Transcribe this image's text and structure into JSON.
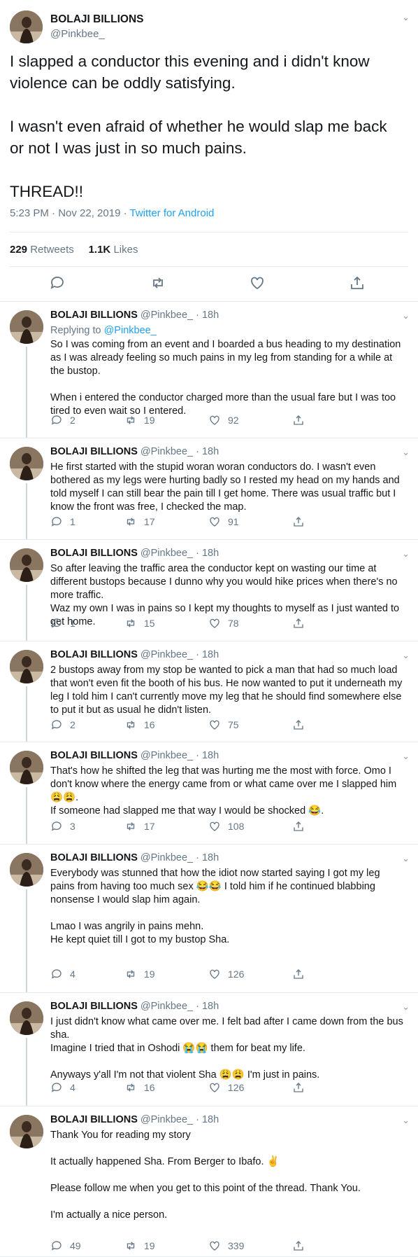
{
  "main_tweet": {
    "display_name": "BOLAJI BILLIONS",
    "handle": "@Pinkbee_",
    "text": "I slapped a conductor this evening and i didn't know violence can be oddly satisfying.\n\nI wasn't even afraid of whether he would slap me back or not I was just in so much pains.\n\nTHREAD!!",
    "timestamp": "5:23 PM · Nov 22, 2019 · ",
    "source": "Twitter for Android",
    "retweets_count": "229",
    "retweets_label": "Retweets",
    "likes_count": "1.1K",
    "likes_label": "Likes",
    "actions": [
      "reply-icon",
      "retweet-icon",
      "like-icon",
      "share-icon"
    ]
  },
  "replies": [
    {
      "display_name": "BOLAJI BILLIONS",
      "meta": "@Pinkbee_ · 18h",
      "replying_to_label": "Replying to ",
      "replying_to": "@Pinkbee_",
      "text": "So I was coming from an event and I boarded a bus heading to my destination as I was already feeling so much pains in my leg from standing for a while at the bustop.\n\nWhen i entered the conductor charged more than the usual fare but I was too tired to even wait so I entered.",
      "replies": "2",
      "retweets": "19",
      "likes": "92"
    },
    {
      "display_name": "BOLAJI BILLIONS",
      "meta": "@Pinkbee_ · 18h",
      "text": "He first started with the stupid woran woran conductors do. I wasn't even bothered as my legs were hurting badly so I rested my head on my hands and told myself I can still bear the pain till I get home. There was usual traffic but I know the front was free, I checked the map.",
      "replies": "1",
      "retweets": "17",
      "likes": "91"
    },
    {
      "display_name": "BOLAJI BILLIONS",
      "meta": "@Pinkbee_ · 18h",
      "text": "So after leaving the traffic area the conductor kept on wasting our time at different bustops because I dunno why you would hike prices when there's no more traffic.\nWaz my own I was in pains so I kept my thoughts to myself as I just wanted to get home.",
      "replies": "1",
      "retweets": "15",
      "likes": "78"
    },
    {
      "display_name": "BOLAJI BILLIONS",
      "meta": "@Pinkbee_ · 18h",
      "text": "2 bustops away from my stop be wanted to pick a man that had so much load that won't even fit the booth of his bus. He now wanted to put it underneath my leg I told him I can't currently move my leg that he should find somewhere else to put it but as usual he didn't listen.",
      "replies": "2",
      "retweets": "16",
      "likes": "75"
    },
    {
      "display_name": "BOLAJI BILLIONS",
      "meta": "@Pinkbee_ · 18h",
      "text": "That's how he shifted the leg that was hurting me the most with force. Omo I don't know where the energy came from or what came over me I slapped him 😩😩.\nIf someone had slapped me that way I would be shocked 😂.",
      "replies": "3",
      "retweets": "17",
      "likes": "108"
    },
    {
      "display_name": "BOLAJI BILLIONS",
      "meta": "@Pinkbee_ · 18h",
      "text": "Everybody was stunned that how the idiot now started saying I got my leg pains from having too much sex 😂😂 I told him if he continued blabbing nonsense I would slap him again.\n\nLmao I was angrily in pains mehn.\nHe kept quiet till I got to my bustop Sha.",
      "replies": "4",
      "retweets": "19",
      "likes": "126"
    },
    {
      "display_name": "BOLAJI BILLIONS",
      "meta": "@Pinkbee_ · 18h",
      "text": "I just didn't know what came over me. I felt bad after I came down from the bus sha.\nImagine I tried that in Oshodi 😭😭 them for beat my life.\n\nAnyways y'all I'm not that violent Sha 😩😩 I'm just in pains.",
      "replies": "4",
      "retweets": "16",
      "likes": "126"
    },
    {
      "display_name": "BOLAJI BILLIONS",
      "meta": "@Pinkbee_ · 18h",
      "text": "Thank You for reading my story\n\nIt actually happened Sha. From Berger to Ibafo. ✌\n\nPlease follow me when you get to this point of the thread. Thank You.\n\nI'm actually a nice person.",
      "replies": "49",
      "retweets": "19",
      "likes": "339"
    }
  ],
  "colors": {
    "accent": "#1da1f2",
    "muted": "#657786",
    "text": "#14171a",
    "divider": "#e6ecf0"
  }
}
